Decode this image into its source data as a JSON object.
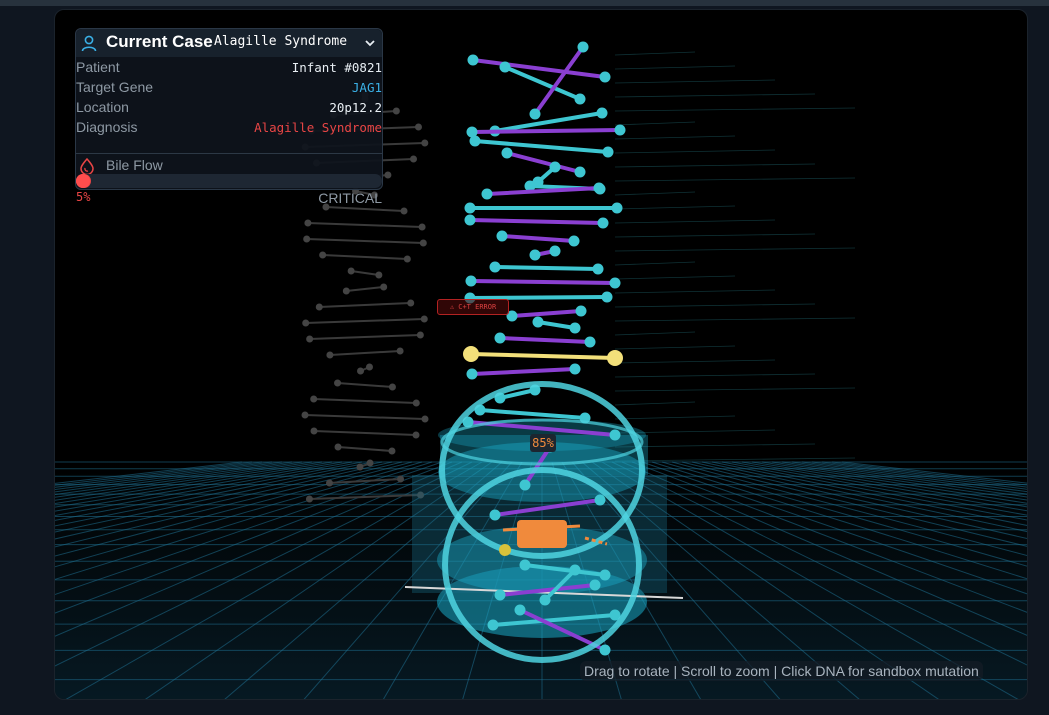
{
  "case": {
    "title": "Current Case",
    "selected_case": "Alagille Syndrome",
    "rows": [
      {
        "label": "Patient",
        "value": "Infant #0821"
      },
      {
        "label": "Target Gene",
        "value": "JAG1"
      },
      {
        "label": "Location",
        "value": "20p12.2"
      },
      {
        "label": "Diagnosis",
        "value": "Alagille Syndrome"
      }
    ],
    "bile_flow": {
      "label": "Bile Flow",
      "percent_text": "5%",
      "percent": 5,
      "status": "CRITICAL"
    }
  },
  "scene": {
    "error_tag": "⚠ C+T ERROR",
    "progress_tag": "85%"
  },
  "hint": "Drag to rotate | Scroll to zoom | Click DNA for sandbox mutation",
  "colors": {
    "cyan": "#3ec6d1",
    "purple": "#8a3fd1",
    "yellow": "#f3e07a",
    "orange": "#f08a3c",
    "critical": "#e84545",
    "gene": "#3ab0e6"
  }
}
